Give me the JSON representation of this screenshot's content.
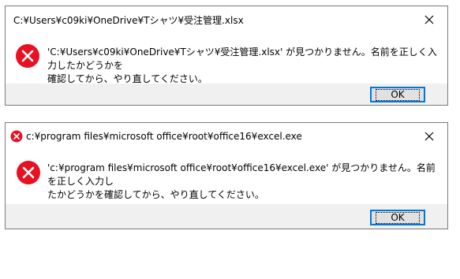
{
  "colors": {
    "error_red": "#e81123",
    "button_border": "#0078d7",
    "footer_bg": "#f0f0f0"
  },
  "dialogs": [
    {
      "title": "C:¥Users¥c09ki¥OneDrive¥Tシャツ¥受注管理.xlsx",
      "message": "'C:¥Users¥c09ki¥OneDrive¥Tシャツ¥受注管理.xlsx' が見つかりません。名前を正しく入力したかどうかを\n確認してから、やり直してください。",
      "ok_label": "OK",
      "icon": "error-icon",
      "close_icon": "close-icon"
    },
    {
      "title": "c:¥program files¥microsoft office¥root¥office16¥excel.exe",
      "message": "'c:¥program files¥microsoft office¥root¥office16¥excel.exe' が見つかりません。名前を正しく入力し\nたかどうかを確認してから、やり直してください。",
      "ok_label": "OK",
      "icon": "error-icon",
      "title_icon": "error-icon",
      "close_icon": "close-icon"
    }
  ]
}
